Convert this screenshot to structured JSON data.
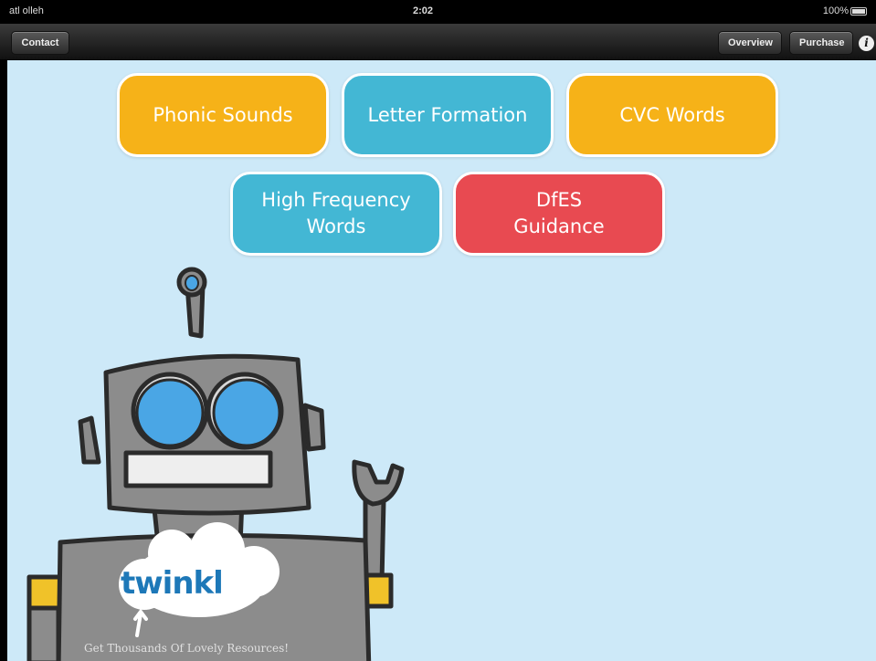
{
  "status_bar": {
    "carrier": "atl olleh",
    "time": "2:02",
    "battery": "100%"
  },
  "nav": {
    "contact": "Contact",
    "overview": "Overview",
    "purchase": "Purchase",
    "info_icon": "i"
  },
  "menu": {
    "phonic_sounds": "Phonic Sounds",
    "letter_formation": "Letter Formation",
    "cvc_words": "CVC Words",
    "high_frequency_line1": "High Frequency",
    "high_frequency_line2": "Words",
    "dfes_line1": "DfES",
    "dfes_line2": "Guidance"
  },
  "branding": {
    "logo": "twinkl",
    "tagline": "Get Thousands Of Lovely Resources!"
  },
  "colors": {
    "background": "#cde9f8",
    "orange": "#f6b218",
    "blue": "#43b7d4",
    "red": "#e84a51"
  }
}
